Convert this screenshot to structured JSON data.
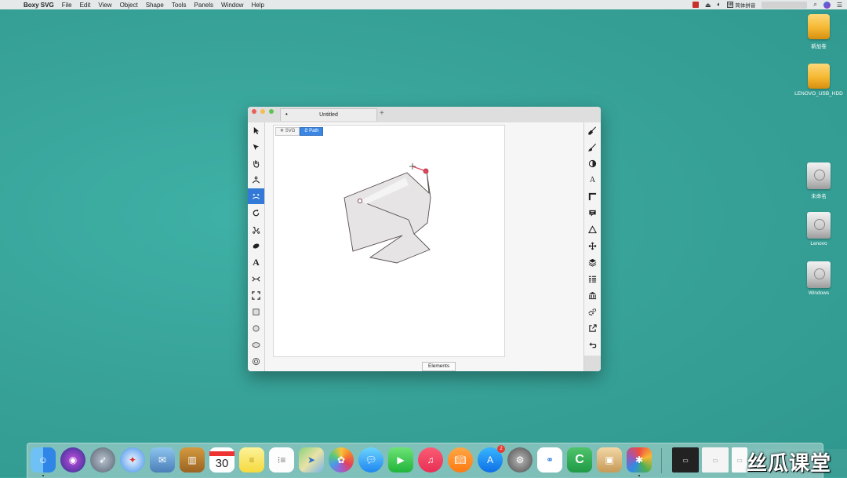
{
  "menubar": {
    "app_name": "Boxy SVG",
    "items": [
      "File",
      "Edit",
      "View",
      "Object",
      "Shape",
      "Tools",
      "Panels",
      "Window",
      "Help"
    ],
    "input_method": "简体拼音",
    "input_badge": "拼"
  },
  "desktop_icons": [
    {
      "label": "新加卷"
    },
    {
      "label": "LENOVO_USB_HDD"
    },
    {
      "label": "未命名"
    },
    {
      "label": "Lenovo"
    },
    {
      "label": "Windows"
    }
  ],
  "window": {
    "tab_title": "Untitled",
    "tab_dot": "•",
    "new_tab": "+",
    "mode_tabs": [
      {
        "label": "SVG",
        "icon": "gear-icon",
        "active": false
      },
      {
        "label": "Path",
        "icon": "path-icon",
        "active": true
      }
    ],
    "elements_button": "Elements",
    "left_tools": [
      "selection-arrow-icon",
      "direct-selection-icon",
      "hand-icon",
      "pen-curve-icon",
      "edit-path-icon",
      "rotate-icon",
      "bezier-icon",
      "blob-icon",
      "text-icon",
      "shape-morph-icon",
      "crop-frame-icon",
      "square-icon",
      "circle-icon",
      "ellipse-icon",
      "ring-icon"
    ],
    "right_tools": [
      "paint-brush-icon",
      "brush-icon",
      "contrast-icon",
      "font-icon",
      "corner-icon",
      "comment-icon",
      "triangle-icon",
      "move-icon",
      "layers-icon",
      "list-icon",
      "library-icon",
      "gears-icon",
      "export-icon",
      "undo-icon"
    ],
    "active_left_tool_index": 4,
    "text_tool_glyph": "A",
    "font_tool_glyph": "A"
  },
  "dock": {
    "calendar_day": "30",
    "appstore_badge": "2"
  },
  "watermark": "丝瓜课堂",
  "colors": {
    "desktop": "#3aa69c",
    "accent": "#3279d8",
    "path_fill": "#e6e4e4",
    "anchor_red": "#e0475d"
  }
}
